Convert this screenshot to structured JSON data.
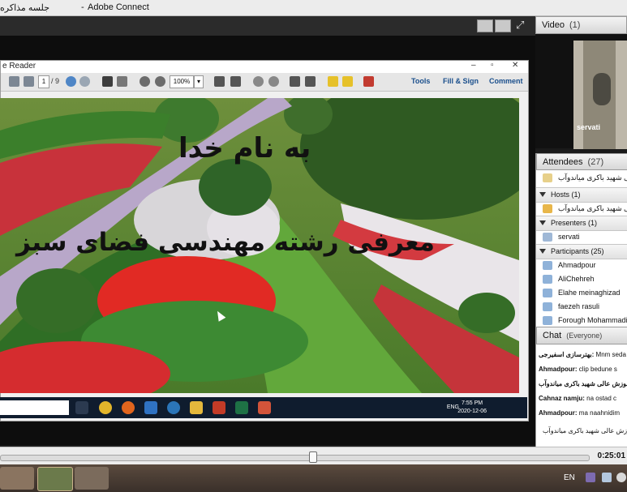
{
  "window": {
    "title": "Adobe Connect",
    "meeting_title": "جلسه مذاکره",
    "separator": "-"
  },
  "pdf": {
    "window_title": "e Reader",
    "page_current": "1",
    "page_total": "/ 9",
    "zoom": "100%",
    "tools_label": "Tools",
    "fill_sign_label": "Fill & Sign",
    "comment_label": "Comment",
    "win_minimize": "–",
    "win_maximize": "▫",
    "win_close": "✕"
  },
  "slide": {
    "line1": "به نام خدا",
    "line2": "معرفی رشته مهندسی فضای سبز"
  },
  "inner_taskbar": {
    "lang": "ENG",
    "time": "7:55 PM",
    "date": "2020-12-06"
  },
  "video": {
    "title": "Video",
    "count": "(1)",
    "name": "servati"
  },
  "attendees": {
    "title": "Attendees",
    "count": "(27)",
    "top_row": "آموزش عالی شهید باکری میاندوآب",
    "hosts_label": "Hosts (1)",
    "host": "آموزش عالی شهید باکری میاندوآب",
    "presenters_label": "Presenters (1)",
    "presenter": "servati",
    "participants_label": "Participants (25)",
    "participants": [
      "Ahmadpour",
      "AliChehreh",
      "Elahe meinaghizad",
      "faezeh rasuli",
      "Forough Mohammadi"
    ]
  },
  "chat": {
    "title": "Chat",
    "scope": "(Everyone)",
    "messages": [
      {
        "sender": "بهترسازی اسفیرجی:",
        "text": " Mnm seda"
      },
      {
        "sender": "Ahmadpour:",
        "text": " clip bedune s"
      },
      {
        "sender": "آموزش عالی شهید باکری میاندوآب",
        "text": ""
      },
      {
        "sender": "Cahnaz namju:",
        "text": " na ostad c"
      },
      {
        "sender": "Ahmadpour:",
        "text": " ma naahnidim"
      },
      {
        "sender": "",
        "text": "آموزش عالی شهید باکری میاندوآب"
      }
    ]
  },
  "playback": {
    "time": "0:25:01",
    "progress": 0.53
  },
  "taskbar": {
    "lang": "EN"
  }
}
